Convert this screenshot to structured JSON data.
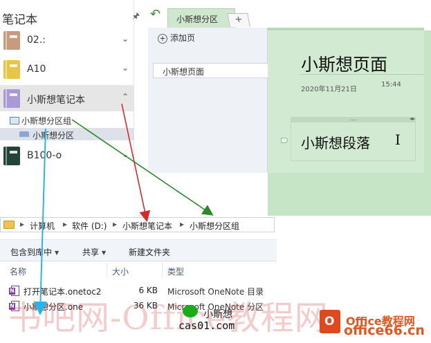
{
  "notebooks_pane": {
    "title": "笔记本",
    "pin_icon": "pin-icon",
    "items": [
      {
        "label": "02.:",
        "color": "#c79c7d",
        "chevron": "⌄"
      },
      {
        "label": "A10",
        "color": "#e8c547",
        "chevron": "⌄"
      },
      {
        "label": "小斯想笔记本",
        "color": "#a99ad6",
        "chevron": "⌃"
      },
      {
        "label": "B100-o",
        "color": "#24443a",
        "chevron": "⌄"
      }
    ],
    "section_group": "小斯想分区组",
    "section": "小斯想分区"
  },
  "onenote": {
    "undo_icon": "↶",
    "section_tab": "小斯想分区",
    "add_tab": "+",
    "add_page_label": "添加页",
    "page_list": [
      "小斯想页面"
    ],
    "page_title": "小斯想页面",
    "page_date": "2020年11月21日",
    "page_time": "15:44",
    "container_grip": "....",
    "container_arrows": "◂▸",
    "paragraph": "小斯想段落",
    "cursor": "I"
  },
  "explorer": {
    "breadcrumb": [
      "计算机",
      "软件 (D:)",
      "小斯想笔记本",
      "小斯想分区组"
    ],
    "breadcrumb_sep": "▸",
    "toolbar": {
      "include_library": "包含到库中",
      "share": "共享",
      "new_folder": "新建文件夹",
      "caret": "▼"
    },
    "columns": {
      "name": "名称",
      "size": "大小",
      "type": "类型"
    },
    "files": [
      {
        "name": "打开笔记本.onetoc2",
        "size": "6 KB",
        "type": "Microsoft OneNote 目录"
      },
      {
        "name": "小斯想分区.one",
        "size": "36 KB",
        "type": "Microsoft OneNote 分区"
      }
    ]
  },
  "watermark": {
    "site_text": "书吧网-Office教程网",
    "author": "小斯想",
    "domain": "cas01.com",
    "brand_line1": "Office教程网",
    "brand_line2": "office66.cn"
  },
  "colors": {
    "arrow_red": "#d42a2a",
    "arrow_green": "#2a8a2a",
    "arrow_cyan": "#29b3e8",
    "canvas_green": "#d2e9d2"
  }
}
